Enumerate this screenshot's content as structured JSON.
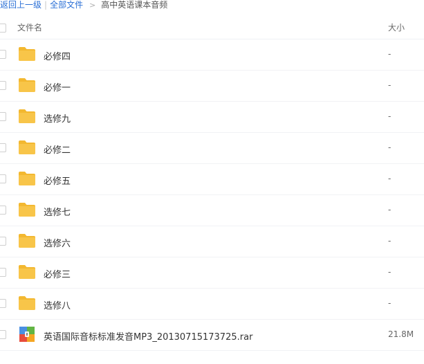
{
  "breadcrumb": {
    "back": "返回上一级",
    "all_files": "全部文件",
    "current": "高中英语课本音频"
  },
  "header": {
    "name_col": "文件名",
    "size_col": "大小"
  },
  "files": [
    {
      "name": "必修四",
      "size": "-",
      "icon": "folder-icon"
    },
    {
      "name": "必修一",
      "size": "-",
      "icon": "folder-icon"
    },
    {
      "name": "选修九",
      "size": "-",
      "icon": "folder-icon"
    },
    {
      "name": "必修二",
      "size": "-",
      "icon": "folder-icon"
    },
    {
      "name": "必修五",
      "size": "-",
      "icon": "folder-icon"
    },
    {
      "name": "选修七",
      "size": "-",
      "icon": "folder-icon"
    },
    {
      "name": "选修六",
      "size": "-",
      "icon": "folder-icon"
    },
    {
      "name": "必修三",
      "size": "-",
      "icon": "folder-icon"
    },
    {
      "name": "选修八",
      "size": "-",
      "icon": "folder-icon"
    },
    {
      "name": "英语国际音标标准发音MP3_20130715173725.rar",
      "size": "21.8M",
      "icon": "archive-icon"
    }
  ],
  "colors": {
    "link": "#2a6fd6",
    "folder": "#f8c549",
    "folder_tab": "#f3b830"
  }
}
